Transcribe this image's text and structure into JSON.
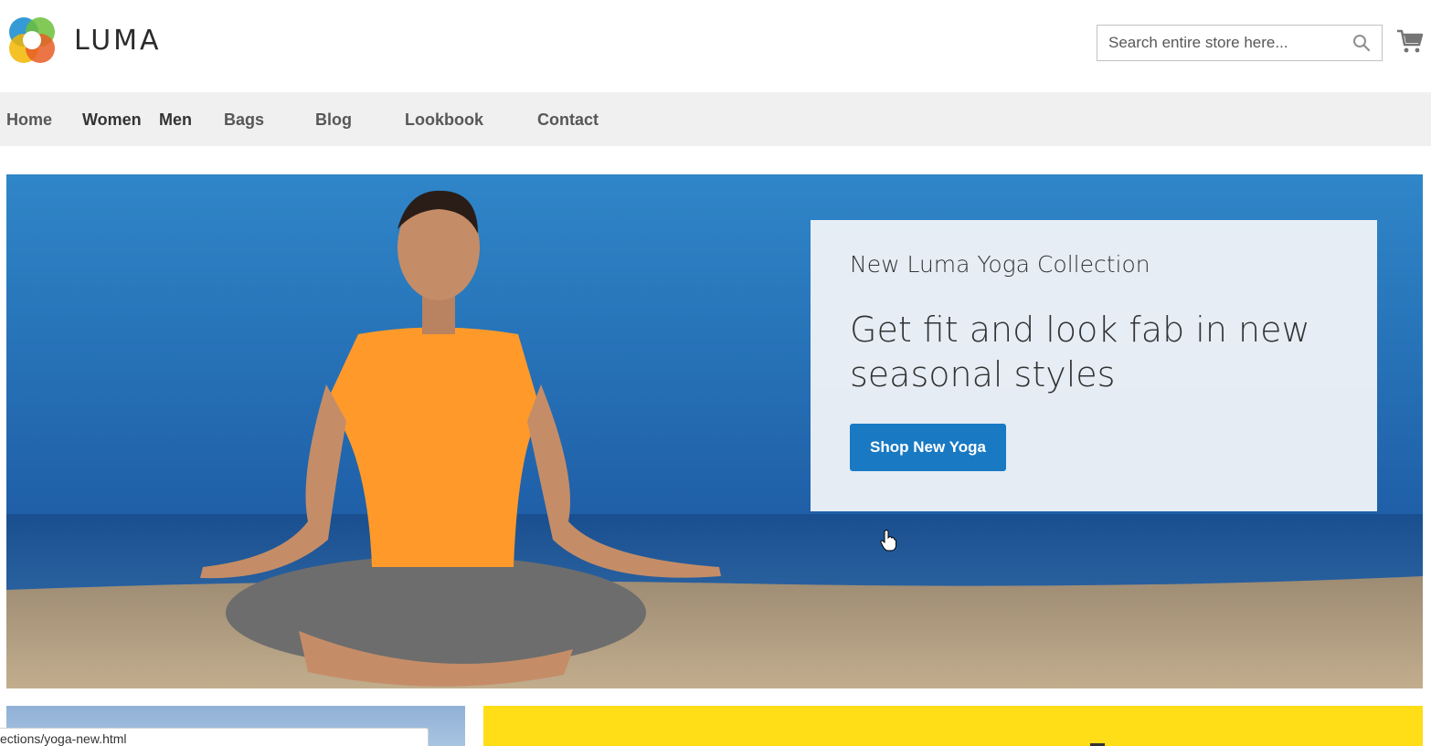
{
  "brand": {
    "name": "LUMA"
  },
  "search": {
    "placeholder": "Search entire store here..."
  },
  "icons": {
    "search": "search-icon",
    "cart": "shopping-cart-icon",
    "logo": "luma-logo-icon",
    "cursor": "hand-pointer-icon"
  },
  "nav": {
    "items": [
      {
        "label": "Home"
      },
      {
        "label": "Women"
      },
      {
        "label": "Men"
      },
      {
        "label": "Bags"
      },
      {
        "label": "Blog"
      },
      {
        "label": "Lookbook"
      },
      {
        "label": "Contact"
      }
    ]
  },
  "hero": {
    "subtitle": "New Luma Yoga Collection",
    "title": "Get fit and look fab in new seasonal styles",
    "button_label": "Shop New Yoga"
  },
  "status": {
    "url": "ections/yoga-new.html"
  },
  "colors": {
    "accent": "#1979c3",
    "nav_bg": "#f0f0f0",
    "tile_yellow": "#ffdd17"
  }
}
